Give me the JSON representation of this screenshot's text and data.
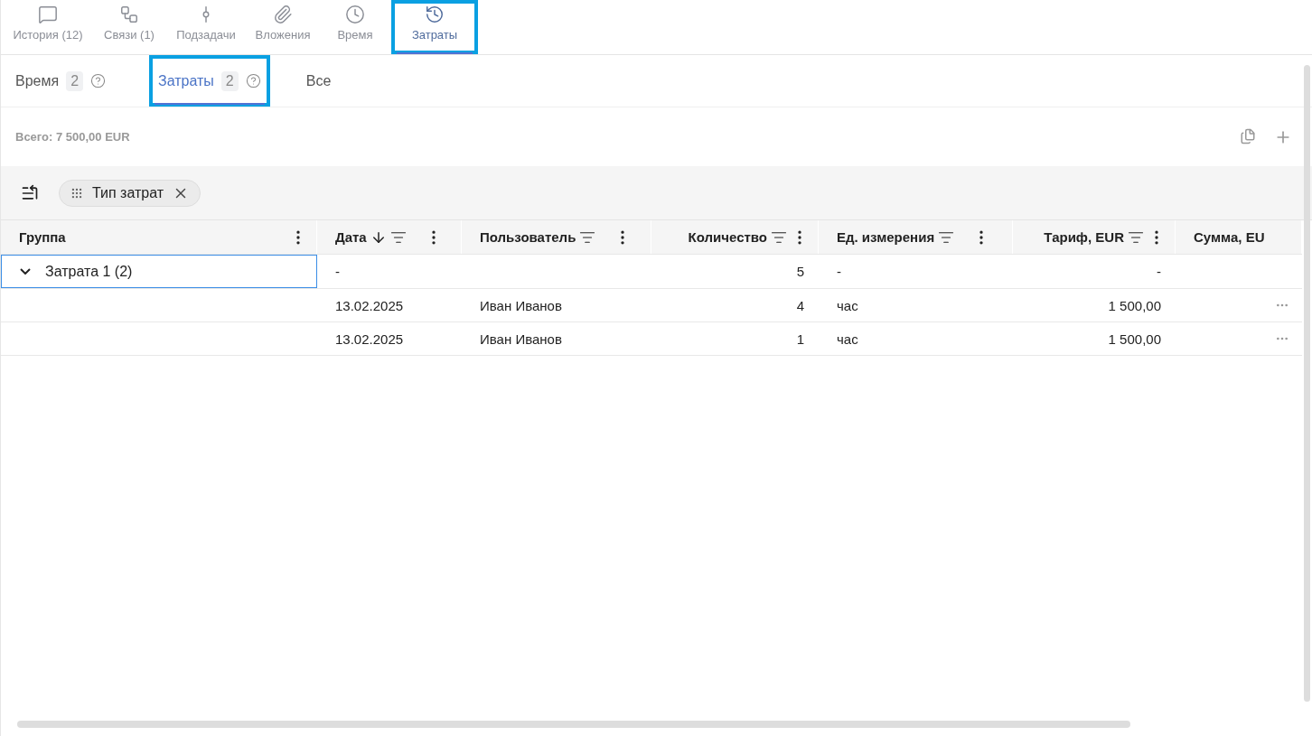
{
  "top_tabs": [
    {
      "kind": "history",
      "label": "История (12)",
      "selected": false,
      "highlighted": false
    },
    {
      "kind": "links",
      "label": "Связи (1)",
      "selected": false,
      "highlighted": false
    },
    {
      "kind": "subtasks",
      "label": "Подзадачи",
      "selected": false,
      "highlighted": false
    },
    {
      "kind": "attachments",
      "label": "Вложения",
      "selected": false,
      "highlighted": false
    },
    {
      "kind": "time",
      "label": "Время",
      "selected": false,
      "highlighted": false
    },
    {
      "kind": "costs",
      "label": "Затраты",
      "selected": true,
      "highlighted": true
    }
  ],
  "sub_tabs": [
    {
      "label": "Время",
      "count": "2",
      "help": true,
      "selected": false,
      "highlighted": false
    },
    {
      "label": "Затраты",
      "count": "2",
      "help": true,
      "selected": true,
      "highlighted": true
    },
    {
      "label": "Все",
      "help": false,
      "selected": false,
      "highlighted": false
    }
  ],
  "total": "Всего: 7 500,00 EUR",
  "group_chip": "Тип затрат",
  "table": {
    "columns": [
      {
        "label": "Группа",
        "sorted": false,
        "filter": false,
        "menu": true
      },
      {
        "label": "Дата",
        "sorted": true,
        "filter": true,
        "menu": true
      },
      {
        "label": "Пользователь",
        "sorted": false,
        "filter": true,
        "menu": true
      },
      {
        "label": "Количество",
        "sorted": false,
        "filter": true,
        "menu": true
      },
      {
        "label": "Ед. измерения",
        "sorted": false,
        "filter": true,
        "menu": true
      },
      {
        "label": "Тариф, EUR",
        "sorted": false,
        "filter": true,
        "menu": true
      },
      {
        "label": "Сумма, EU",
        "sorted": false,
        "filter": false,
        "menu": false
      }
    ],
    "groups": [
      {
        "label": "Затрата 1 (2)",
        "expanded": true,
        "cells": [
          "-",
          "",
          "5",
          "-",
          "-",
          ""
        ],
        "children": [
          {
            "cells": [
              "13.02.2025",
              "Иван Иванов",
              "4",
              "час",
              "1 500,00",
              ""
            ],
            "actions": true
          },
          {
            "cells": [
              "13.02.2025",
              "Иван Иванов",
              "1",
              "час",
              "1 500,00",
              ""
            ],
            "actions": true
          }
        ]
      }
    ]
  }
}
